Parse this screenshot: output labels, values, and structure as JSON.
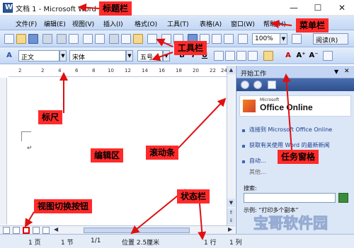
{
  "window": {
    "title": "文档 1 - Microsoft Word"
  },
  "menu": [
    "文件(F)",
    "编辑(E)",
    "视图(V)",
    "插入(I)",
    "格式(O)",
    "工具(T)",
    "表格(A)",
    "窗口(W)",
    "帮助(H)"
  ],
  "toolbar": {
    "zoom": "100%",
    "read_label": "阅读(R)"
  },
  "format": {
    "style": "正文",
    "font": "宋体",
    "size": "五号",
    "bold": "B",
    "italic": "I",
    "underline": "U",
    "font_color": "A"
  },
  "ruler": {
    "ticks": [
      "2",
      "2",
      "4",
      "6",
      "8",
      "10",
      "12",
      "14",
      "16",
      "18",
      "20",
      "22",
      "24"
    ]
  },
  "document": {
    "paragraph_mark": "↵"
  },
  "status": {
    "page": "1 页",
    "section": "1 节",
    "page_of": "1/1",
    "position": "位置 2.5厘米",
    "line": "1 行",
    "col": "1 列"
  },
  "task_pane": {
    "title": "开始工作",
    "office_brand": "Microsoft",
    "office_name": "Office Online",
    "links": [
      "连接到 Microsoft Office Online",
      "获取有关使用 Word 的最新新闻",
      "自动…",
      "其他…"
    ],
    "search_label": "搜索:",
    "example": "示例: “打印多个副本”"
  },
  "annotations": {
    "title_bar": "标题栏",
    "menu_bar": "菜单栏",
    "toolbar": "工具栏",
    "ruler": "标尺",
    "edit_area": "编辑区",
    "scrollbar": "滚动条",
    "task_pane": "任务窗格",
    "view_switch": "视图切换按钮",
    "status_bar": "状态栏"
  },
  "watermark": "宝哥软件园",
  "colors": {
    "callout": "#ff2a2a",
    "chrome": "#c2d6f4",
    "taskpane": "#dbe6f7"
  }
}
